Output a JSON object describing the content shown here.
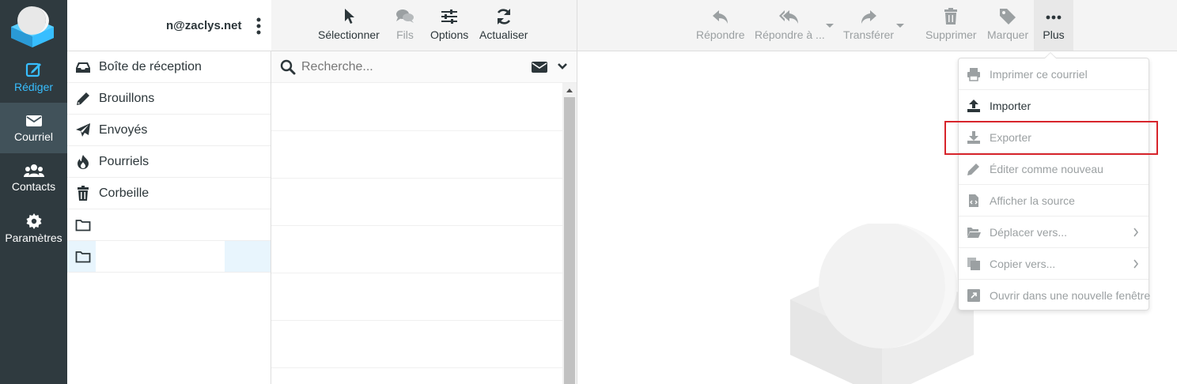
{
  "nav": {
    "compose": "Rédiger",
    "mail": "Courriel",
    "contacts": "Contacts",
    "settings": "Paramètres"
  },
  "account": {
    "name_visible": "n@zaclys.net"
  },
  "folders": [
    {
      "label": "Boîte de réception",
      "icon": "inbox-icon"
    },
    {
      "label": "Brouillons",
      "icon": "pencil-icon"
    },
    {
      "label": "Envoyés",
      "icon": "paper-plane-icon"
    },
    {
      "label": "Pourriels",
      "icon": "fire-icon"
    },
    {
      "label": "Corbeille",
      "icon": "trash-icon"
    },
    {
      "label": "",
      "icon": "folder-icon"
    },
    {
      "label": "",
      "icon": "folder-icon"
    }
  ],
  "list_toolbar": {
    "select": "Sélectionner",
    "threads": "Fils",
    "options": "Options",
    "refresh": "Actualiser"
  },
  "search": {
    "placeholder": "Recherche..."
  },
  "content_toolbar": {
    "reply": "Répondre",
    "reply_all": "Répondre à ...",
    "forward": "Transférer",
    "delete": "Supprimer",
    "mark": "Marquer",
    "more": "Plus"
  },
  "more_menu": {
    "print": "Imprimer ce courriel",
    "import": "Importer",
    "export": "Exporter",
    "edit_as_new": "Éditer comme nouveau",
    "view_source": "Afficher la source",
    "move_to": "Déplacer vers...",
    "copy_to": "Copier vers...",
    "open_new_window": "Ouvrir dans une nouvelle fenêtre"
  },
  "colors": {
    "nav_bg": "#2f3a3f",
    "nav_selected": "#41525a",
    "accent": "#37beff",
    "highlight_box": "#d7242b",
    "disabled_text": "#9ba0a2"
  }
}
